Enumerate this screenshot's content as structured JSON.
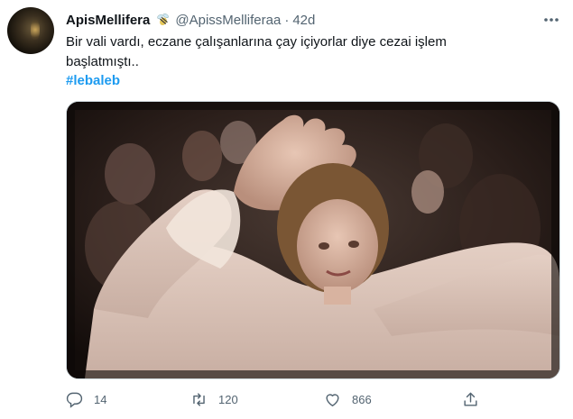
{
  "tweet": {
    "display_name": "ApisMellifera",
    "handle": "@ApissMelliferaa",
    "separator": "·",
    "time": "42d",
    "text": "Bir vali vardı, eczane çalışanlarına çay içiyorlar diye cezai işlem başlatmıştı..",
    "hashtag": "#lebaleb"
  },
  "actions": {
    "reply_count": "14",
    "retweet_count": "120",
    "like_count": "866"
  },
  "icons": {
    "verified_emoji": "bee-icon",
    "more": "more-icon",
    "reply": "reply-icon",
    "retweet": "retweet-icon",
    "like": "heart-icon",
    "share": "share-icon"
  },
  "colors": {
    "link": "#1d9bf0",
    "secondary_text": "#536471"
  }
}
